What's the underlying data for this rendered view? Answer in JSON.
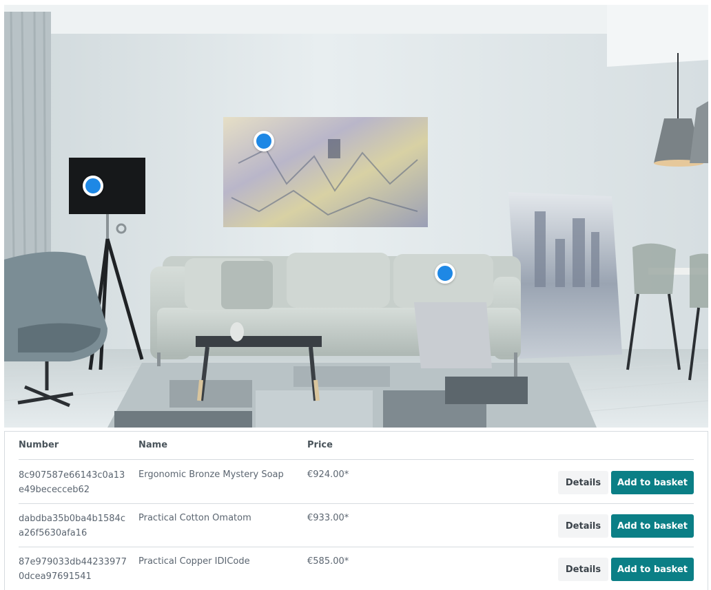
{
  "image": {
    "hotspots": [
      {
        "name": "hotspot-floor-lamp",
        "label": "floor lamp"
      },
      {
        "name": "hotspot-wall-painting",
        "label": "wall painting"
      },
      {
        "name": "hotspot-sofa-cushion",
        "label": "sofa cushion"
      }
    ]
  },
  "table": {
    "headers": {
      "number": "Number",
      "name": "Name",
      "price": "Price"
    },
    "rows": [
      {
        "number": "8c907587e66143c0a13e49bececceb62",
        "name": "Ergonomic Bronze Mystery Soap",
        "price": "€924.00*"
      },
      {
        "number": "dabdba35b0ba4b1584ca26f5630afa16",
        "name": "Practical Cotton Omatom",
        "price": "€933.00*"
      },
      {
        "number": "87e979033db442339770dcea97691541",
        "name": "Practical Copper IDICode",
        "price": "€585.00*"
      }
    ],
    "details_label": "Details",
    "basket_label": "Add to basket"
  },
  "colors": {
    "hotspot": "#1e88e5",
    "basket_button": "#0b7f86",
    "details_button": "#f3f4f5"
  }
}
